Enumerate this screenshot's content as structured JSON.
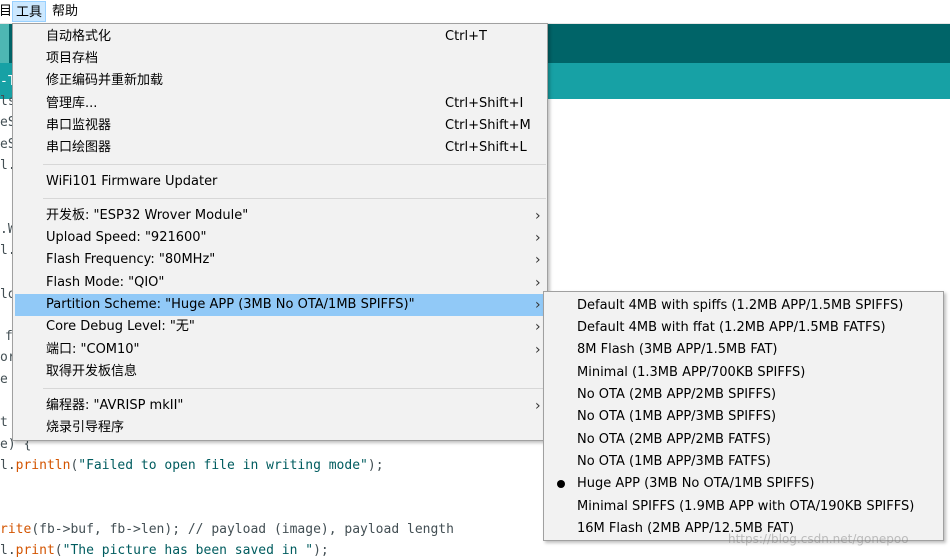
{
  "menubar": {
    "partial_item": "目",
    "tools": "工具",
    "help": "帮助"
  },
  "editor_fragments": {
    "l1": "-T",
    "l2": "ls",
    "l3": "eS",
    "l4": "eS",
    "l5": "l.",
    "l6": ".W",
    "l7": "l.",
    "l8": "lo",
    "l9": "f",
    "l10": "or",
    "l11": "e",
    "l12": "t",
    "l13": "e) {",
    "l14_a": "l.",
    "l14_fn": "println",
    "l14_b": "(",
    "l14_str": "\"Failed to open file in writing mode\"",
    "l14_c": ");",
    "l15_a": "",
    "l15_fn": "rite",
    "l15_b": "(fb->buf, fb->len); // payload (image), payload length",
    "l16_a": "l.",
    "l16_fn": "print",
    "l16_b": "(",
    "l16_str": "\"The picture has been saved in \"",
    "l16_c": ");"
  },
  "tools_menu": {
    "items": [
      {
        "label": "自动格式化",
        "shortcut": "Ctrl+T"
      },
      {
        "label": "项目存档",
        "shortcut": ""
      },
      {
        "label": "修正编码并重新加载",
        "shortcut": ""
      },
      {
        "label": "管理库...",
        "shortcut": "Ctrl+Shift+I"
      },
      {
        "label": "串口监视器",
        "shortcut": "Ctrl+Shift+M"
      },
      {
        "label": "串口绘图器",
        "shortcut": "Ctrl+Shift+L"
      },
      {
        "label": "WiFi101 Firmware Updater",
        "shortcut": ""
      },
      {
        "label": "开发板: \"ESP32 Wrover Module\"",
        "shortcut": ""
      },
      {
        "label": "Upload Speed: \"921600\"",
        "shortcut": ""
      },
      {
        "label": "Flash Frequency: \"80MHz\"",
        "shortcut": ""
      },
      {
        "label": "Flash Mode: \"QIO\"",
        "shortcut": ""
      },
      {
        "label": "Partition Scheme: \"Huge APP (3MB No OTA/1MB SPIFFS)\"",
        "shortcut": ""
      },
      {
        "label": "Core Debug Level: \"无\"",
        "shortcut": ""
      },
      {
        "label": "端口: \"COM10\"",
        "shortcut": ""
      },
      {
        "label": "取得开发板信息",
        "shortcut": ""
      },
      {
        "label": "编程器: \"AVRISP mkII\"",
        "shortcut": ""
      },
      {
        "label": "烧录引导程序",
        "shortcut": ""
      }
    ],
    "submenu_arrow": "›"
  },
  "partition_submenu": {
    "items": [
      {
        "label": "Default 4MB with spiffs (1.2MB APP/1.5MB SPIFFS)"
      },
      {
        "label": "Default 4MB with ffat (1.2MB APP/1.5MB FATFS)"
      },
      {
        "label": "8M Flash (3MB APP/1.5MB FAT)"
      },
      {
        "label": "Minimal (1.3MB APP/700KB SPIFFS)"
      },
      {
        "label": "No OTA (2MB APP/2MB SPIFFS)"
      },
      {
        "label": "No OTA (1MB APP/3MB SPIFFS)"
      },
      {
        "label": "No OTA (2MB APP/2MB FATFS)"
      },
      {
        "label": "No OTA (1MB APP/3MB FATFS)"
      },
      {
        "label": "Huge APP (3MB No OTA/1MB SPIFFS)"
      },
      {
        "label": "Minimal SPIFFS (1.9MB APP with OTA/190KB SPIFFS)"
      },
      {
        "label": "16M Flash (2MB APP/12.5MB FAT)"
      }
    ],
    "selected_index": 8
  },
  "watermark": "https://blog.csdn.net/gonepoo",
  "colors": {
    "toolbar": "#006468",
    "tab_bar": "#17a1a5",
    "menu_bg": "#f2f2f2",
    "highlight": "#91c9f7",
    "menubar_open": "#cce8ff"
  }
}
